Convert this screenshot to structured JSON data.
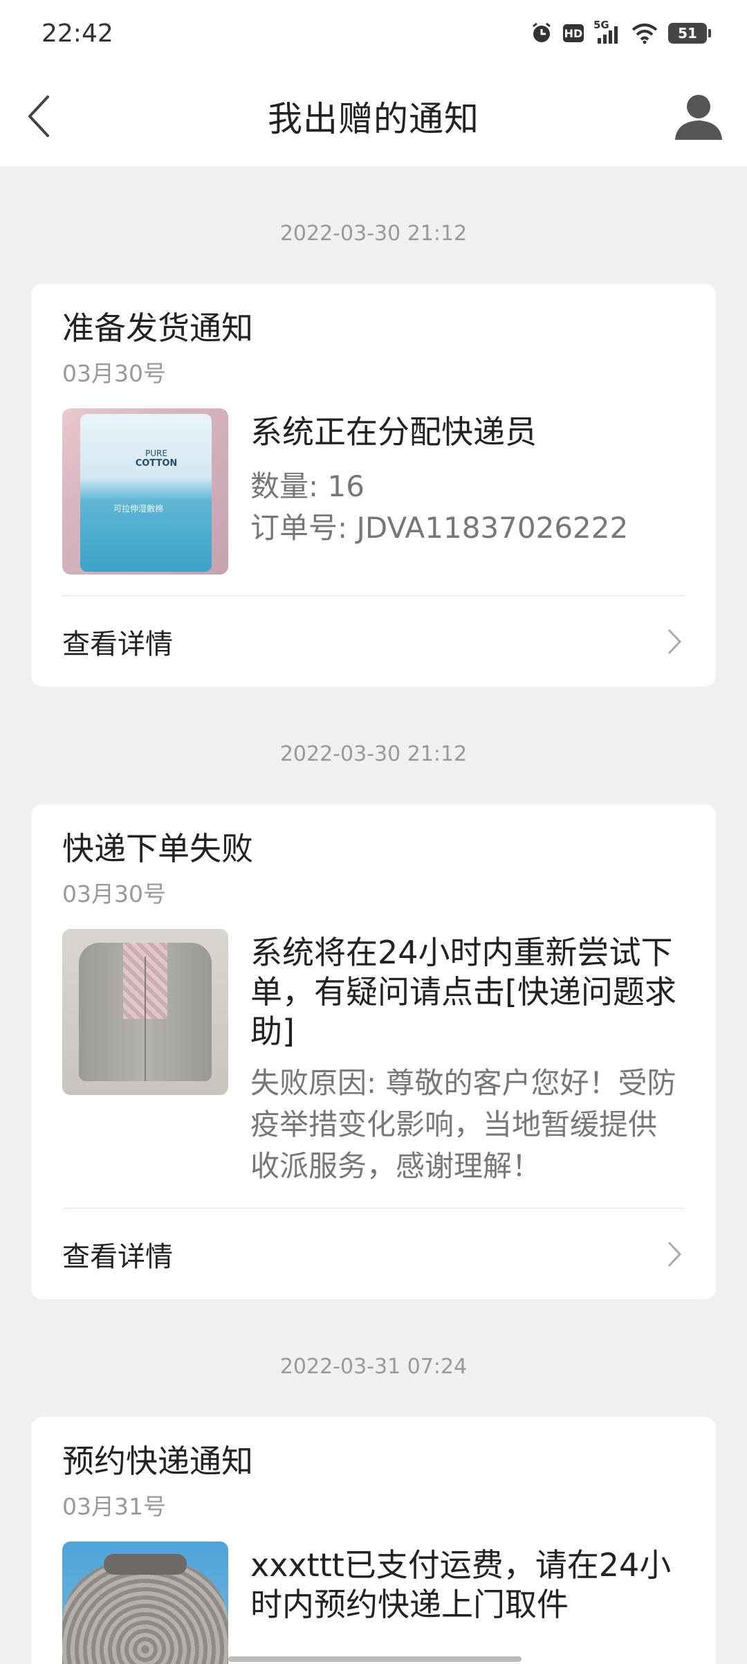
{
  "status_bar": {
    "time": "22:42",
    "network": "5G",
    "hd": "HD",
    "battery": "51"
  },
  "header": {
    "title": "我出赠的通知"
  },
  "notifications": [
    {
      "timestamp": "2022-03-30 21:12",
      "title": "准备发货通知",
      "date": "03月30号",
      "headline": "系统正在分配快递员",
      "info": [
        "数量: 16",
        "订单号: JDVA11837026222"
      ],
      "thumb_text": [
        "PURE",
        "COTTON",
        "可拉伸湿敷棉"
      ],
      "link": "查看详情"
    },
    {
      "timestamp": "2022-03-30 21:12",
      "title": "快递下单失败",
      "date": "03月30号",
      "headline": "系统将在24小时内重新尝试下单，有疑问请点击[快递问题求助]",
      "reason": "失败原因: 尊敬的客户您好！受防疫举措变化影响，当地暂缓提供收派服务，感谢理解！",
      "link": "查看详情"
    },
    {
      "timestamp": "2022-03-31 07:24",
      "title": "预约快递通知",
      "date": "03月31号",
      "headline": "xxxttt已支付运费，请在24小时内预约快递上门取件"
    }
  ],
  "icons": {
    "back": "chevron-left-icon",
    "avatar": "user-icon",
    "chevron": "chevron-right-icon",
    "alarm": "alarm-icon",
    "signal": "signal-icon",
    "wifi": "wifi-icon"
  }
}
